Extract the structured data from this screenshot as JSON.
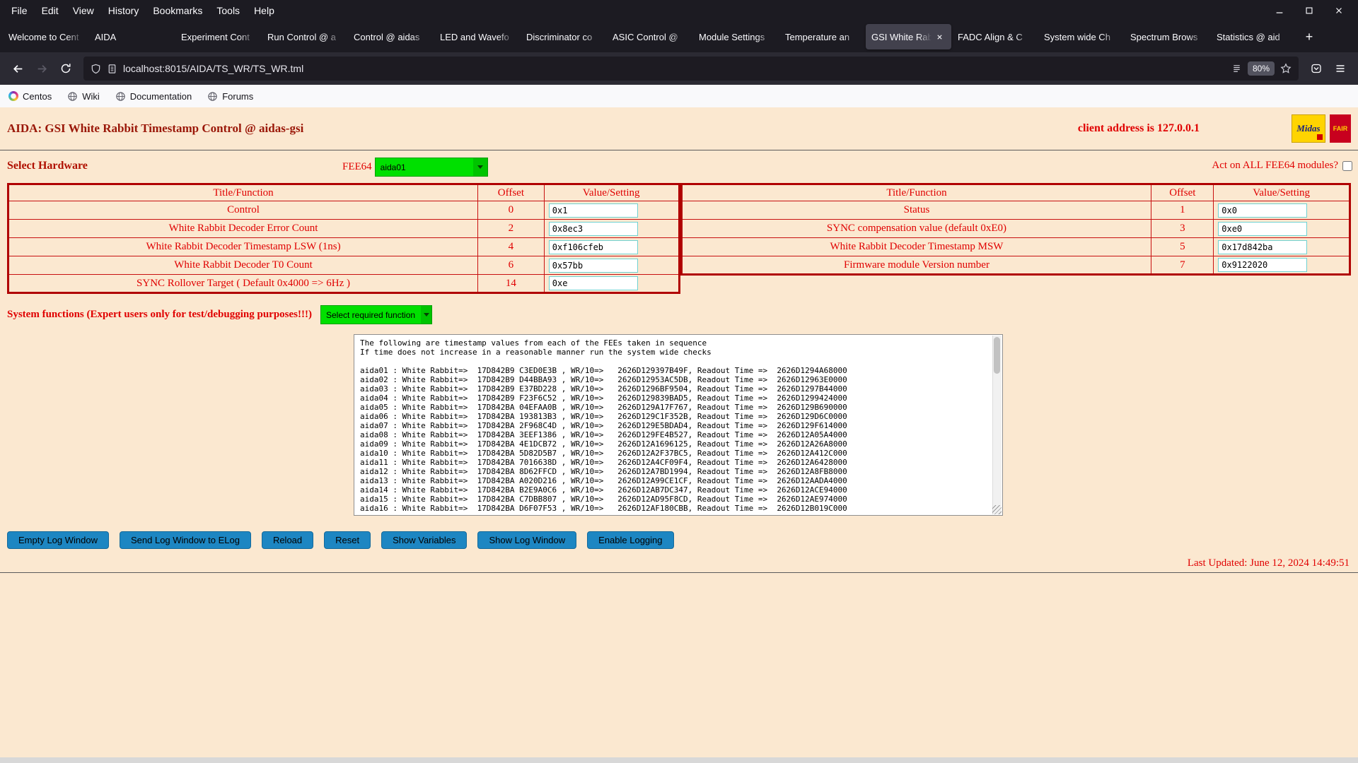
{
  "browser": {
    "menu": [
      "File",
      "Edit",
      "View",
      "History",
      "Bookmarks",
      "Tools",
      "Help"
    ],
    "tabs": [
      {
        "label": "Welcome to Cent"
      },
      {
        "label": "AIDA"
      },
      {
        "label": "Experiment Cont"
      },
      {
        "label": "Run Control @ a"
      },
      {
        "label": "Control @ aidas"
      },
      {
        "label": "LED and Wavefo"
      },
      {
        "label": "Discriminator co"
      },
      {
        "label": "ASIC Control @"
      },
      {
        "label": "Module Settings"
      },
      {
        "label": "Temperature an"
      },
      {
        "label": "GSI White Rab"
      },
      {
        "label": "FADC Align & C"
      },
      {
        "label": "System wide Ch"
      },
      {
        "label": "Spectrum Brows"
      },
      {
        "label": "Statistics @ aid"
      }
    ],
    "new_tab_button": "+",
    "url": "localhost:8015/AIDA/TS_WR/TS_WR.tml",
    "zoom_level": "80%",
    "bookmarks": [
      "Centos",
      "Wiki",
      "Documentation",
      "Forums"
    ]
  },
  "page": {
    "title": "AIDA: GSI White Rabbit Timestamp Control @ aidas-gsi",
    "client_address": "client address is 127.0.0.1",
    "logos": {
      "midas": "Midas",
      "fair": "FAIR"
    },
    "hardware": {
      "label": "Select Hardware",
      "fee64_label": "FEE64",
      "fee64_selected": "aida01",
      "act_all_label": "Act on ALL FEE64 modules?"
    },
    "table_headers": [
      "Title/Function",
      "Offset",
      "Value/Setting"
    ],
    "left_table": {
      "rows": [
        {
          "title": "Control",
          "offset": "0",
          "value": "0x1"
        },
        {
          "title": "White Rabbit Decoder Error Count",
          "offset": "2",
          "value": "0x8ec3"
        },
        {
          "title": "White Rabbit Decoder Timestamp LSW (1ns)",
          "offset": "4",
          "value": "0xf106cfeb"
        },
        {
          "title": "White Rabbit Decoder T0 Count",
          "offset": "6",
          "value": "0x57bb"
        },
        {
          "title": "SYNC Rollover Target ( Default 0x4000 => 6Hz )",
          "offset": "14",
          "value": "0xe"
        }
      ]
    },
    "right_table": {
      "rows": [
        {
          "title": "Status",
          "offset": "1",
          "value": "0x0"
        },
        {
          "title": "SYNC compensation value (default 0xE0)",
          "offset": "3",
          "value": "0xe0"
        },
        {
          "title": "White Rabbit Decoder Timestamp MSW",
          "offset": "5",
          "value": "0x17d842ba"
        },
        {
          "title": "Firmware module Version number",
          "offset": "7",
          "value": "0x9122020"
        }
      ]
    },
    "system_functions": {
      "label": "System functions (Expert users only for test/debugging purposes!!!)",
      "select_placeholder": "Select required function"
    },
    "log_text": "The following are timestamp values from each of the FEEs taken in sequence\nIf time does not increase in a reasonable manner run the system wide checks\n\naida01 : White Rabbit=>  17D842B9 C3ED0E3B , WR/10=>   2626D129397B49F, Readout Time =>  2626D1294A68000\naida02 : White Rabbit=>  17D842B9 D44BBA93 , WR/10=>   2626D12953AC5DB, Readout Time =>  2626D12963E0000\naida03 : White Rabbit=>  17D842B9 E37BD228 , WR/10=>   2626D1296BF9504, Readout Time =>  2626D1297B44000\naida04 : White Rabbit=>  17D842B9 F23F6C52 , WR/10=>   2626D129839BAD5, Readout Time =>  2626D1299424000\naida05 : White Rabbit=>  17D842BA 04EFAA0B , WR/10=>   2626D129A17F767, Readout Time =>  2626D129B690000\naida06 : White Rabbit=>  17D842BA 193813B3 , WR/10=>   2626D129C1F352B, Readout Time =>  2626D129D6C0000\naida07 : White Rabbit=>  17D842BA 2F968C4D , WR/10=>   2626D129E5BDAD4, Readout Time =>  2626D129F614000\naida08 : White Rabbit=>  17D842BA 3EEF1386 , WR/10=>   2626D129FE4B527, Readout Time =>  2626D12A05A4000\naida09 : White Rabbit=>  17D842BA 4E1DCB72 , WR/10=>   2626D12A1696125, Readout Time =>  2626D12A26A8000\naida10 : White Rabbit=>  17D842BA 5D82D5B7 , WR/10=>   2626D12A2F37BC5, Readout Time =>  2626D12A412C000\naida11 : White Rabbit=>  17D842BA 7016638D , WR/10=>   2626D12A4CF09F4, Readout Time =>  2626D12A6428000\naida12 : White Rabbit=>  17D842BA 8D62FFCD , WR/10=>   2626D12A7BD1994, Readout Time =>  2626D12A8FB8000\naida13 : White Rabbit=>  17D842BA A020D216 , WR/10=>   2626D12A99CE1CF, Readout Time =>  2626D12AADA4000\naida14 : White Rabbit=>  17D842BA B2E9A0C6 , WR/10=>   2626D12AB7DC347, Readout Time =>  2626D12ACE94000\naida15 : White Rabbit=>  17D842BA C7DBB807 , WR/10=>   2626D12AD95F8CD, Readout Time =>  2626D12AE974000\naida16 : White Rabbit=>  17D842BA D6F07F53 , WR/10=>   2626D12AF180CBB, Readout Time =>  2626D12B019C000",
    "buttons": [
      "Empty Log Window",
      "Send Log Window to ELog",
      "Reload",
      "Reset",
      "Show Variables",
      "Show Log Window",
      "Enable Logging"
    ],
    "last_updated": "Last Updated: June 12, 2024 14:49:51"
  }
}
